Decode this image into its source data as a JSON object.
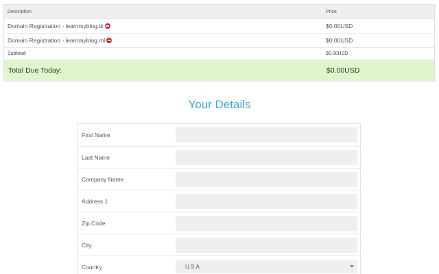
{
  "cart": {
    "headers": {
      "description": "Description",
      "price": "Price"
    },
    "items": [
      {
        "description": "Domain Registration - learnmyblog.tk",
        "price": "$0.00USD"
      },
      {
        "description": "Domain Registration - learnmyblog.ml",
        "price": "$0.00USD"
      }
    ],
    "subtotal": {
      "label": "Subtotal:",
      "value": "$0.00USD"
    },
    "total": {
      "label": "Total Due Today:",
      "value": "$0.00USD"
    },
    "colors": {
      "total_bg": "#dff6cc",
      "remove_icon": "#d9232e"
    },
    "remove_icon": "minus-circle-icon"
  },
  "details": {
    "title": "Your Details",
    "title_color": "#3fa9d8",
    "fields": {
      "first_name": {
        "label": "First Name",
        "value": ""
      },
      "last_name": {
        "label": "Last Name",
        "value": ""
      },
      "company_name": {
        "label": "Company Name",
        "value": ""
      },
      "address1": {
        "label": "Address 1",
        "value": ""
      },
      "zip_code": {
        "label": "Zip Code",
        "value": ""
      },
      "city": {
        "label": "City",
        "value": ""
      },
      "country": {
        "label": "Country",
        "value": "U.S.A."
      }
    }
  }
}
